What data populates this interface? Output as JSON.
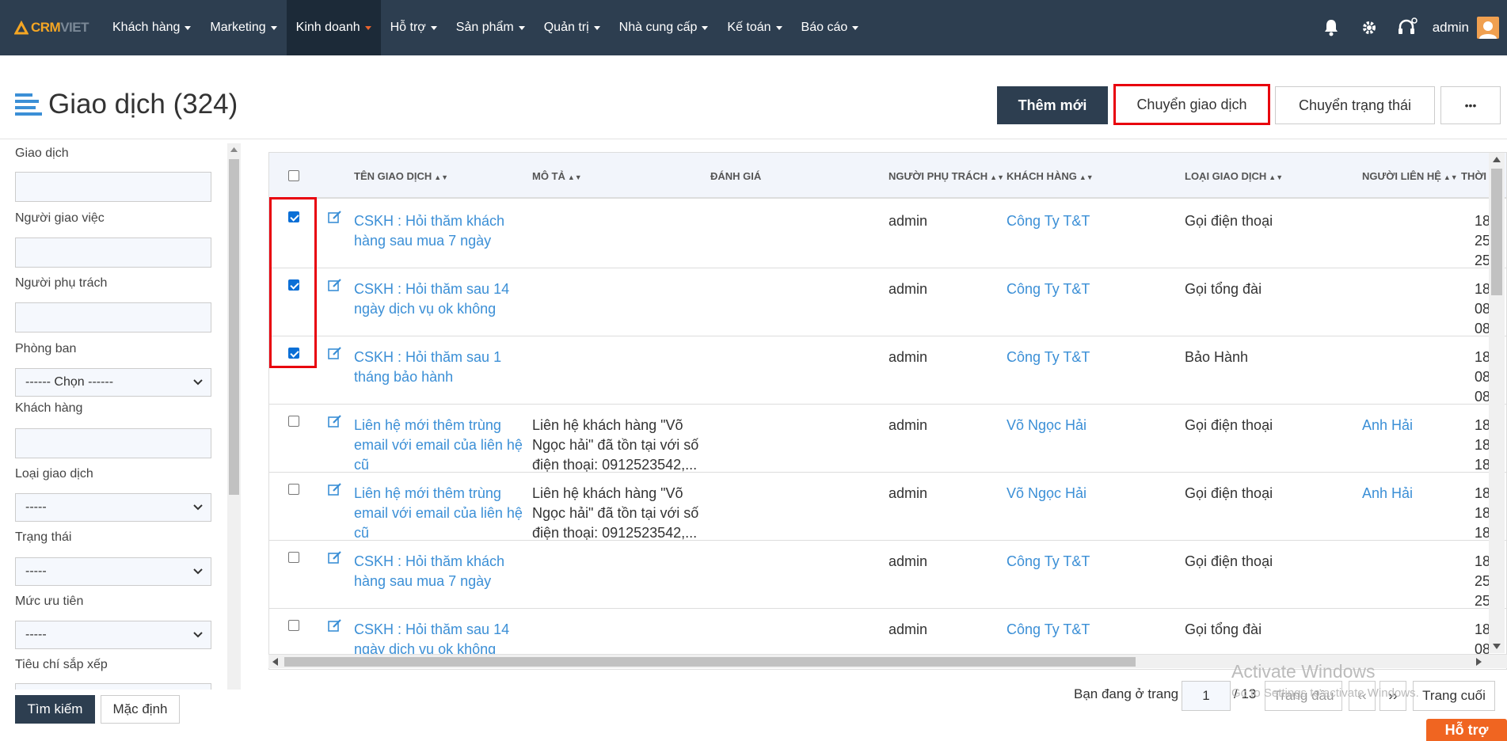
{
  "nav": {
    "logo_a": "CRM",
    "logo_b": "VIET",
    "items": [
      "Khách hàng",
      "Marketing",
      "Kinh doanh",
      "Hỗ trợ",
      "Sản phẩm",
      "Quản trị",
      "Nhà cung cấp",
      "Kế toán",
      "Báo cáo"
    ],
    "active_index": 2,
    "user": "admin"
  },
  "header": {
    "title": "Giao dịch (324)",
    "btn_add": "Thêm mới",
    "btn_transfer": "Chuyển giao dịch",
    "btn_status": "Chuyển trạng thái",
    "btn_more": "•••"
  },
  "filters": {
    "giao_dich": "Giao dịch",
    "nguoi_giao_viec": "Người giao việc",
    "nguoi_phu_trach": "Người phụ trách",
    "phong_ban": "Phòng ban",
    "phong_ban_value": "------ Chọn ------",
    "khach_hang": "Khách hàng",
    "loai_giao_dich": "Loại giao dịch",
    "loai_value": "-----",
    "trang_thai": "Trạng thái",
    "trang_thai_value": "-----",
    "muc_uu_tien": "Mức ưu tiên",
    "muc_value": "-----",
    "tieu_chi": "Tiêu chí sắp xếp",
    "btn_search": "Tìm kiếm",
    "btn_default": "Mặc định"
  },
  "table": {
    "headers": {
      "name": "TÊN GIAO DỊCH",
      "desc": "MÔ TẢ",
      "rating": "ĐÁNH GIÁ",
      "owner": "NGƯỜI PHỤ TRÁCH",
      "customer": "KHÁCH HÀNG",
      "type": "LOẠI GIAO DỊCH",
      "contact": "NGƯỜI LIÊN HỆ",
      "time": "THỜI"
    },
    "rows": [
      {
        "checked": true,
        "name1": "CSKH : Hỏi thăm khách",
        "name2": "hàng sau mua 7 ngày",
        "name3": "",
        "desc1": "",
        "desc2": "",
        "desc3": "",
        "owner": "admin",
        "customer": "Công Ty T&T",
        "type": "Gọi điện thoại",
        "contact": "",
        "t1": "18",
        "t2": "25",
        "t3": "25"
      },
      {
        "checked": true,
        "name1": "CSKH : Hỏi thăm sau 14",
        "name2": "ngày dịch vụ ok không",
        "name3": "",
        "desc1": "",
        "desc2": "",
        "desc3": "",
        "owner": "admin",
        "customer": "Công Ty T&T",
        "type": "Gọi tổng đài",
        "contact": "",
        "t1": "18",
        "t2": "08",
        "t3": "08"
      },
      {
        "checked": true,
        "name1": "CSKH : Hỏi thăm sau 1",
        "name2": "tháng bảo hành",
        "name3": "",
        "desc1": "",
        "desc2": "",
        "desc3": "",
        "owner": "admin",
        "customer": "Công Ty T&T",
        "type": "Bảo Hành",
        "contact": "",
        "t1": "18",
        "t2": "08",
        "t3": "08"
      },
      {
        "checked": false,
        "name1": "Liên hệ mới thêm trùng",
        "name2": "email với email của liên hệ",
        "name3": "cũ",
        "desc1": "Liên hệ khách hàng \"Võ",
        "desc2": "Ngọc hải\" đã tồn tại với số",
        "desc3": "điện thoại: 0912523542,...",
        "owner": "admin",
        "customer": "Võ Ngọc Hải",
        "type": "Gọi điện thoại",
        "contact": "Anh Hải",
        "t1": "18",
        "t2": "18",
        "t3": "18"
      },
      {
        "checked": false,
        "name1": "Liên hệ mới thêm trùng",
        "name2": "email với email của liên hệ",
        "name3": "cũ",
        "desc1": "Liên hệ khách hàng \"Võ",
        "desc2": "Ngọc hải\" đã tồn tại với số",
        "desc3": "điện thoại: 0912523542,...",
        "owner": "admin",
        "customer": "Võ Ngọc Hải",
        "type": "Gọi điện thoại",
        "contact": "Anh Hải",
        "t1": "18",
        "t2": "18",
        "t3": "18"
      },
      {
        "checked": false,
        "name1": "CSKH : Hỏi thăm khách",
        "name2": "hàng sau mua 7 ngày",
        "name3": "",
        "desc1": "",
        "desc2": "",
        "desc3": "",
        "owner": "admin",
        "customer": "Công Ty T&T",
        "type": "Gọi điện thoại",
        "contact": "",
        "t1": "18",
        "t2": "25",
        "t3": "25"
      },
      {
        "checked": false,
        "name1": "CSKH : Hỏi thăm sau 14",
        "name2": "ngày dịch vụ ok không",
        "name3": "",
        "desc1": "",
        "desc2": "",
        "desc3": "",
        "owner": "admin",
        "customer": "Công Ty T&T",
        "type": "Gọi tổng đài",
        "contact": "",
        "t1": "18",
        "t2": "08",
        "t3": ""
      }
    ]
  },
  "pager": {
    "label": "Bạn đang ở trang",
    "page": "1",
    "total": "/ 13",
    "first": "Trang đầu",
    "prev": "‹‹",
    "next": "››",
    "last": "Trang cuối"
  },
  "watermark": {
    "line1": "Activate Windows",
    "line2": "Go to Settings to activate Windows."
  },
  "support": "Hỗ trợ"
}
